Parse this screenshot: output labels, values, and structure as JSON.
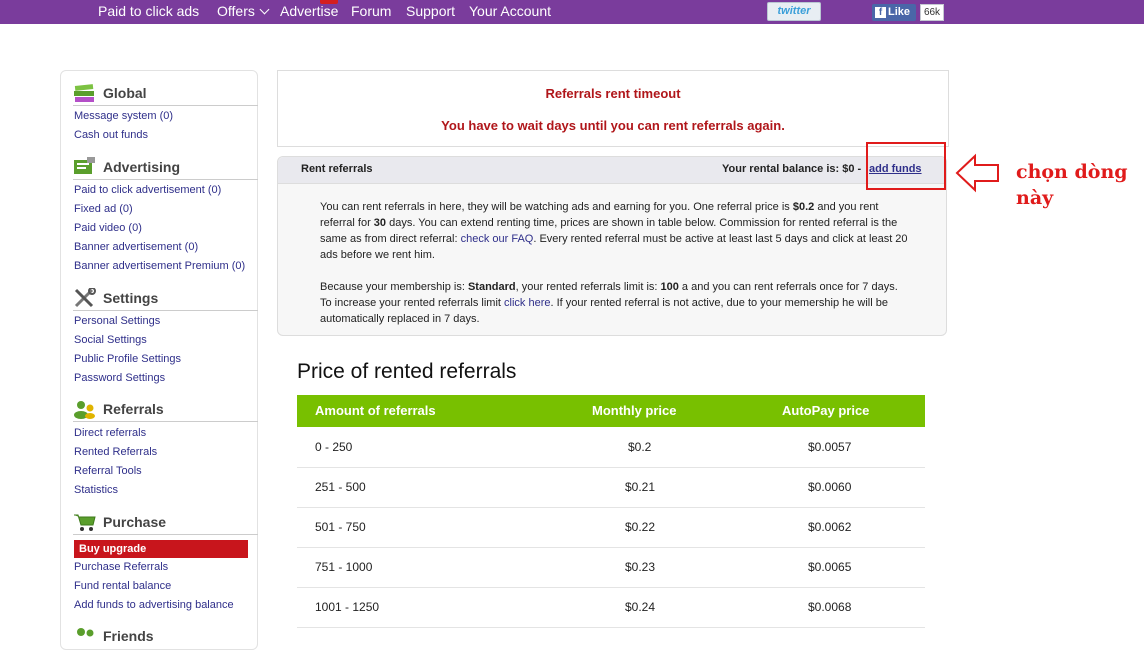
{
  "nav": {
    "items": [
      "Paid to click ads",
      "Offers",
      "Advertise",
      "Forum",
      "Support",
      "Your Account"
    ],
    "twitter_label": "twitter",
    "fb_like_label": "Like",
    "fb_count": "66k"
  },
  "sidebar": {
    "global": {
      "title": "Global",
      "links": [
        "Message system (0)",
        "Cash out funds"
      ]
    },
    "advertising": {
      "title": "Advertising",
      "links": [
        "Paid to click advertisement (0)",
        "Fixed ad (0)",
        "Paid video (0)",
        "Banner advertisement (0)",
        "Banner advertisement Premium (0)"
      ]
    },
    "settings": {
      "title": "Settings",
      "links": [
        "Personal Settings",
        "Social Settings",
        "Public Profile Settings",
        "Password Settings"
      ]
    },
    "referrals": {
      "title": "Referrals",
      "links": [
        "Direct referrals",
        "Rented Referrals",
        "Referral Tools",
        "Statistics"
      ]
    },
    "purchase": {
      "title": "Purchase",
      "buy_upgrade": "Buy upgrade",
      "links": [
        "Purchase Referrals",
        "Fund rental balance",
        "Add funds to advertising balance"
      ]
    },
    "next_section_partial": "Friends"
  },
  "timeout": {
    "title": "Referrals rent timeout",
    "message": "You have to wait days until you can rent referrals again."
  },
  "rent": {
    "header": "Rent referrals",
    "balance_label": "Your rental balance is: $0 -",
    "add_funds": "add funds",
    "p1_a": "You can rent referrals in here, they will be watching ads and earning for you. One referral price is ",
    "p1_price": "$0.2",
    "p1_b": " and you rent referral for ",
    "p1_days": "30",
    "p1_c": " days. You can extend renting time, prices are shown in table below. Commission for rented referral is the same as from direct referral: ",
    "p1_link": "check our FAQ",
    "p1_d": ". Every rented referral must be active at least last 5 days and click at least 20 ads before we rent him.",
    "p2_a": "Because your membership is: ",
    "p2_membership": "Standard",
    "p2_b": ", your rented referrals limit is: ",
    "p2_limit": "100",
    "p2_c": " a and you can rent referrals once for 7 days. To increase your rented referrals limit ",
    "p2_link": "click here",
    "p2_d": ". If your rented referral is not active, due to your memership he will be automatically replaced in 7 days."
  },
  "price": {
    "title": "Price of rented referrals",
    "headers": [
      "Amount of referrals",
      "Monthly price",
      "AutoPay price"
    ],
    "rows": [
      [
        "0 - 250",
        "$0.2",
        "$0.0057"
      ],
      [
        "251 - 500",
        "$0.21",
        "$0.0060"
      ],
      [
        "501 - 750",
        "$0.22",
        "$0.0062"
      ],
      [
        "751 - 1000",
        "$0.23",
        "$0.0065"
      ],
      [
        "1001 - 1250",
        "$0.24",
        "$0.0068"
      ]
    ]
  },
  "annotation": {
    "line1": "chọn dòng",
    "line2": "này",
    "color": "#e01b1b"
  },
  "colors": {
    "nav": "#7a3c9c",
    "table_header": "#78c000",
    "alert": "#b0161a",
    "buy_upgrade": "#c8151c"
  }
}
